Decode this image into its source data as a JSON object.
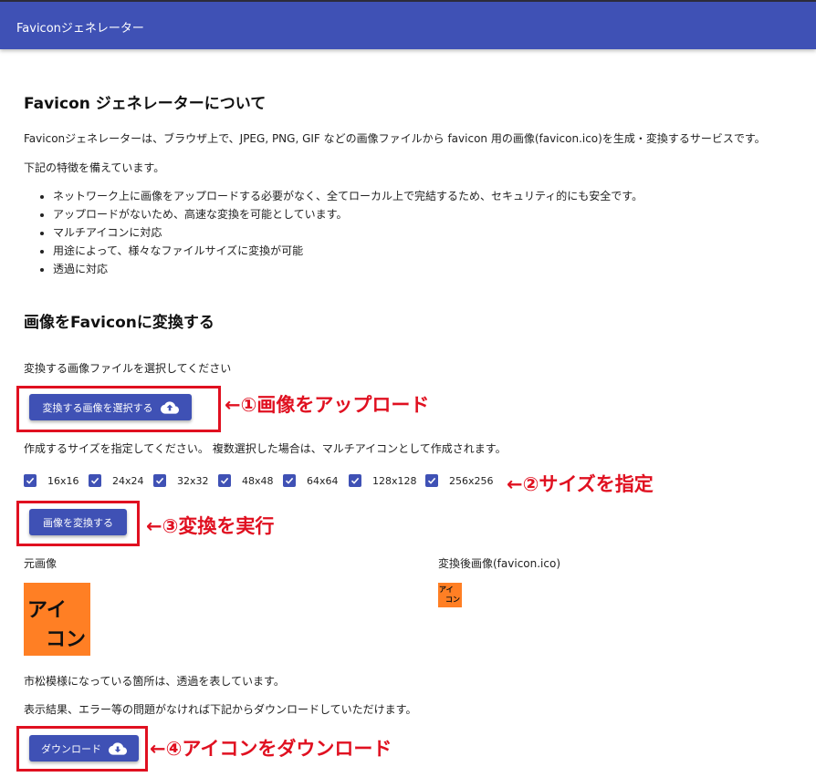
{
  "appbar": {
    "title": "Faviconジェネレーター"
  },
  "about": {
    "heading": "Favicon ジェネレーターについて",
    "description": "Faviconジェネレーターは、ブラウザ上で、JPEG, PNG, GIF などの画像ファイルから favicon 用の画像(favicon.ico)を生成・変換するサービスです。",
    "features_intro": "下記の特徴を備えています。",
    "features": [
      "ネットワーク上に画像をアップロードする必要がなく、全てローカル上で完結するため、セキュリティ的にも安全です。",
      "アップロードがないため、高速な変換を可能としています。",
      "マルチアイコンに対応",
      "用途によって、様々なファイルサイズに変換が可能",
      "透過に対応"
    ]
  },
  "convert": {
    "heading": "画像をFaviconに変換する",
    "select_prompt": "変換する画像ファイルを選択してください",
    "select_button": "変換する画像を選択する",
    "size_prompt": "作成するサイズを指定してください。 複数選択した場合は、マルチアイコンとして作成されます。",
    "sizes": [
      {
        "label": "16x16",
        "checked": true
      },
      {
        "label": "24x24",
        "checked": true
      },
      {
        "label": "32x32",
        "checked": true
      },
      {
        "label": "48x48",
        "checked": true
      },
      {
        "label": "64x64",
        "checked": true
      },
      {
        "label": "128x128",
        "checked": true
      },
      {
        "label": "256x256",
        "checked": true
      }
    ],
    "convert_button": "画像を変換する",
    "original_label": "元画像",
    "converted_label": "変換後画像(favicon.ico)",
    "icon_text_line1": "アイ",
    "icon_text_line2": "コン",
    "transparency_note": "市松模様になっている箇所は、透過を表しています。",
    "download_prompt": "表示結果、エラー等の問題がなければ下記からダウンロードしていただけます。",
    "download_button": "ダウンロード"
  },
  "annotations": {
    "step1": "←①画像をアップロード",
    "step2": "←②サイズを指定",
    "step3": "←③変換を実行",
    "step4": "←④アイコンをダウンロード"
  },
  "colors": {
    "primary": "#3f51b5",
    "annotation": "#e01020",
    "icon_bg": "#ff7f24"
  }
}
